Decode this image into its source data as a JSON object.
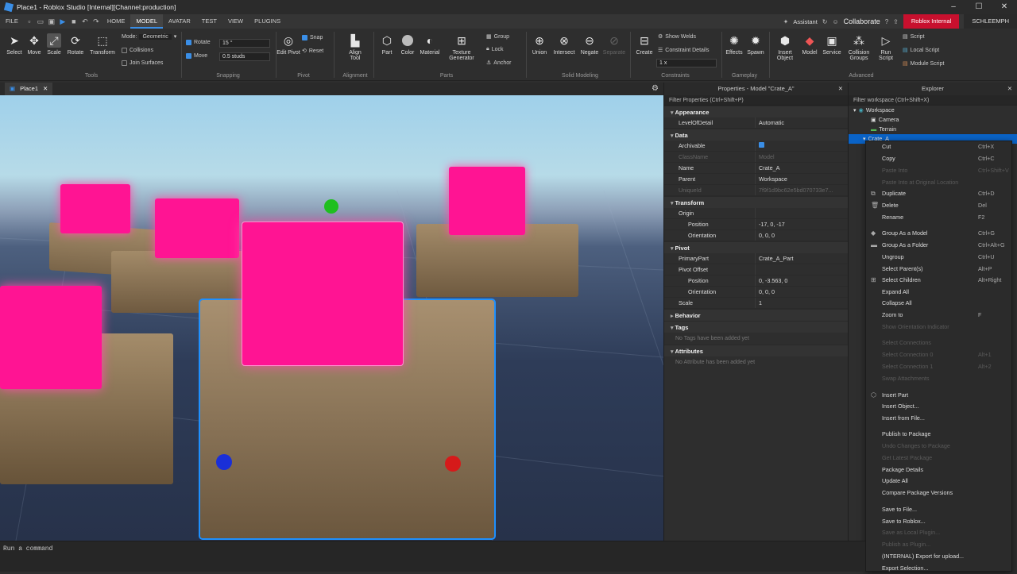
{
  "titlebar": {
    "title": "Place1 - Roblox Studio [Internal][Channel:production]"
  },
  "menubar": {
    "file": "FILE",
    "tabs": [
      "HOME",
      "MODEL",
      "AVATAR",
      "TEST",
      "VIEW",
      "PLUGINS"
    ],
    "assistant": "Assistant",
    "collaborate": "Collaborate",
    "env": "Roblox Internal",
    "user": "SCHLEEMPH"
  },
  "ribbon": {
    "tools": {
      "select": "Select",
      "move": "Move",
      "scale": "Scale",
      "rotate": "Rotate",
      "transform": "Transform",
      "group": "Tools"
    },
    "mode_label": "Mode:",
    "mode_value": "Geometric",
    "collisions": "Collisions",
    "join_surfaces": "Join Surfaces",
    "snapping": {
      "rotate": "Rotate",
      "rotate_val": "15 °",
      "move": "Move",
      "move_val": "0.5 studs",
      "group": "Snapping"
    },
    "pivot": {
      "edit": "Edit Pivot",
      "snap": "Snap",
      "reset": "Reset",
      "group": "Pivot"
    },
    "alignment": {
      "align": "Align Tool",
      "group": "Alignment"
    },
    "parts": {
      "part": "Part",
      "color": "Color",
      "material": "Material",
      "texture": "Texture Generator",
      "grp": "Group",
      "lock": "Lock",
      "anchor": "Anchor",
      "group": "Parts"
    },
    "solid": {
      "union": "Union",
      "intersect": "Intersect",
      "negate": "Negate",
      "separate": "Separate",
      "group": "Solid Modeling"
    },
    "constraints": {
      "create": "Create",
      "show_welds": "Show Welds",
      "details": "Constraint Details",
      "scale": "1 x",
      "group": "Constraints"
    },
    "gameplay": {
      "effects": "Effects",
      "spawn": "Spawn",
      "group": "Gameplay"
    },
    "advanced": {
      "insert": "Insert Object",
      "model": "Model",
      "service": "Service",
      "collision": "Collision Groups",
      "run": "Run Script",
      "script": "Script",
      "local": "Local Script",
      "module": "Module Script",
      "group": "Advanced"
    }
  },
  "viewport": {
    "tab": "Place1"
  },
  "properties": {
    "header": "Properties - Model \"Crate_A\"",
    "filter": "Filter Properties (Ctrl+Shift+P)",
    "sections": {
      "appearance": "Appearance",
      "data": "Data",
      "transform": "Transform",
      "pivot": "Pivot",
      "behavior": "Behavior",
      "tags": "Tags",
      "attributes": "Attributes"
    },
    "lod": [
      "LevelOfDetail",
      "Automatic"
    ],
    "archivable": "Archivable",
    "classname": [
      "ClassName",
      "Model"
    ],
    "name": [
      "Name",
      "Crate_A"
    ],
    "parent": [
      "Parent",
      "Workspace"
    ],
    "uniqueid": [
      "UniqueId",
      "7f9f1d9bc62e5bd070733e7..."
    ],
    "origin": "Origin",
    "position": [
      "Position",
      "-17, 0, -17"
    ],
    "orientation": [
      "Orientation",
      "0, 0, 0"
    ],
    "primarypart": [
      "PrimaryPart",
      "Crate_A_Part"
    ],
    "pivot_offset": "Pivot Offset",
    "pposition": [
      "Position",
      "0, -3.563, 0"
    ],
    "porientation": [
      "Orientation",
      "0, 0, 0"
    ],
    "scale": [
      "Scale",
      "1"
    ],
    "no_tags": "No Tags have been added yet",
    "no_attr": "No Attribute has been added yet"
  },
  "explorer": {
    "header": "Explorer",
    "filter": "Filter workspace (Ctrl+Shift+X)",
    "items": [
      "Workspace",
      "Camera",
      "Terrain",
      "Crate_A"
    ]
  },
  "context_menu": [
    {
      "label": "Cut",
      "shortcut": "Ctrl+X",
      "enabled": true
    },
    {
      "label": "Copy",
      "shortcut": "Ctrl+C",
      "enabled": true
    },
    {
      "label": "Paste Into",
      "shortcut": "Ctrl+Shift+V",
      "enabled": false
    },
    {
      "label": "Paste Into at Original Location",
      "shortcut": "",
      "enabled": false
    },
    {
      "label": "Duplicate",
      "shortcut": "Ctrl+D",
      "enabled": true
    },
    {
      "label": "Delete",
      "shortcut": "Del",
      "enabled": true
    },
    {
      "label": "Rename",
      "shortcut": "F2",
      "enabled": true
    },
    {
      "label": "Group As a Model",
      "shortcut": "Ctrl+G",
      "enabled": true
    },
    {
      "label": "Group As a Folder",
      "shortcut": "Ctrl+Alt+G",
      "enabled": true
    },
    {
      "label": "Ungroup",
      "shortcut": "Ctrl+U",
      "enabled": true
    },
    {
      "label": "Select Parent(s)",
      "shortcut": "Alt+P",
      "enabled": true
    },
    {
      "label": "Select Children",
      "shortcut": "Alt+Right",
      "enabled": true
    },
    {
      "label": "Expand All",
      "shortcut": "",
      "enabled": true
    },
    {
      "label": "Collapse All",
      "shortcut": "",
      "enabled": true
    },
    {
      "label": "Zoom to",
      "shortcut": "F",
      "enabled": true
    },
    {
      "label": "Show Orientation Indicator",
      "shortcut": "",
      "enabled": false
    },
    {
      "label": "Select Connections",
      "shortcut": "",
      "enabled": false
    },
    {
      "label": "Select Connection 0",
      "shortcut": "Alt+1",
      "enabled": false
    },
    {
      "label": "Select Connection 1",
      "shortcut": "Alt+2",
      "enabled": false
    },
    {
      "label": "Swap Attachments",
      "shortcut": "",
      "enabled": false
    },
    {
      "label": "Insert Part",
      "shortcut": "",
      "enabled": true
    },
    {
      "label": "Insert Object...",
      "shortcut": "",
      "enabled": true
    },
    {
      "label": "Insert from File...",
      "shortcut": "",
      "enabled": true
    },
    {
      "label": "Publish to Package",
      "shortcut": "",
      "enabled": true
    },
    {
      "label": "Undo Changes to Package",
      "shortcut": "",
      "enabled": false
    },
    {
      "label": "Get Latest Package",
      "shortcut": "",
      "enabled": false
    },
    {
      "label": "Package Details",
      "shortcut": "",
      "enabled": true
    },
    {
      "label": "Update All",
      "shortcut": "",
      "enabled": true
    },
    {
      "label": "Compare Package Versions",
      "shortcut": "",
      "enabled": true
    },
    {
      "label": "Save to File...",
      "shortcut": "",
      "enabled": true
    },
    {
      "label": "Save to Roblox...",
      "shortcut": "",
      "enabled": true
    },
    {
      "label": "Save as Local Plugin...",
      "shortcut": "",
      "enabled": false
    },
    {
      "label": "Publish as Plugin...",
      "shortcut": "",
      "enabled": false
    },
    {
      "label": "(INTERNAL) Export for upload...",
      "shortcut": "",
      "enabled": true
    },
    {
      "label": "Export Selection...",
      "shortcut": "",
      "enabled": true
    }
  ],
  "command_bar": {
    "placeholder": "Run a command"
  }
}
